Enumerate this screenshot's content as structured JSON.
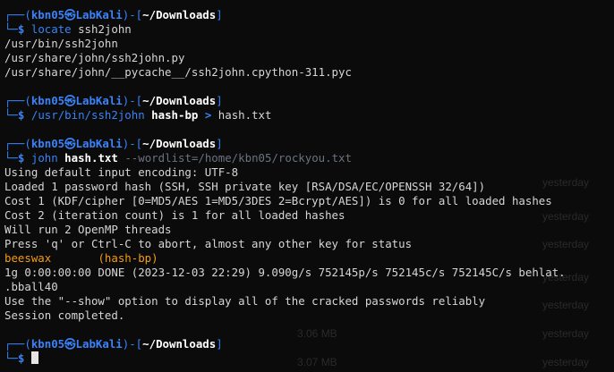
{
  "prompt": {
    "open": "┌──(",
    "user": "kbn05",
    "at": "㉿",
    "host": "LabKali",
    "mid": ")-[",
    "dir": "~/Downloads",
    "close": "]",
    "bottom": "└─",
    "dollar": "$"
  },
  "block1": {
    "cmd": "locate",
    "arg": "ssh2john",
    "out": [
      "/usr/bin/ssh2john",
      "/usr/share/john/ssh2john.py",
      "/usr/share/john/__pycache__/ssh2john.cpython-311.pyc"
    ]
  },
  "block2": {
    "cmd": "/usr/bin/ssh2john",
    "arg": "hash-bp",
    "op": ">",
    "file": "hash.txt"
  },
  "block3": {
    "cmd": "john",
    "arg": "hash.txt",
    "opt": "--wordlist=/home/kbn05/rockyou.txt",
    "out": [
      "Using default input encoding: UTF-8",
      "Loaded 1 password hash (SSH, SSH private key [RSA/DSA/EC/OPENSSH 32/64])",
      "Cost 1 (KDF/cipher [0=MD5/AES 1=MD5/3DES 2=Bcrypt/AES]) is 0 for all loaded hashes",
      "Cost 2 (iteration count) is 1 for all loaded hashes",
      "Will run 2 OpenMP threads",
      "Press 'q' or Ctrl-C to abort, almost any other key for status"
    ],
    "cracked_password": "beeswax",
    "cracked_file": "(hash-bp)",
    "status_line": "1g 0:00:00:00 DONE (2023-12-03 22:29) 9.090g/s 752145p/s 752145c/s 752145C/s behlat.",
    "status_wrap": ".bball40",
    "show_hint": "Use the \"--show\" option to display all of the cracked passwords reliably",
    "complete": "Session completed."
  },
  "background_ghost": [
    "yesterday",
    "yesterday",
    "yesterday",
    "yesterday",
    "yesterday",
    "yesterday",
    "3.06 MB",
    "yesterday",
    "3.07 MB",
    "yesterday"
  ]
}
